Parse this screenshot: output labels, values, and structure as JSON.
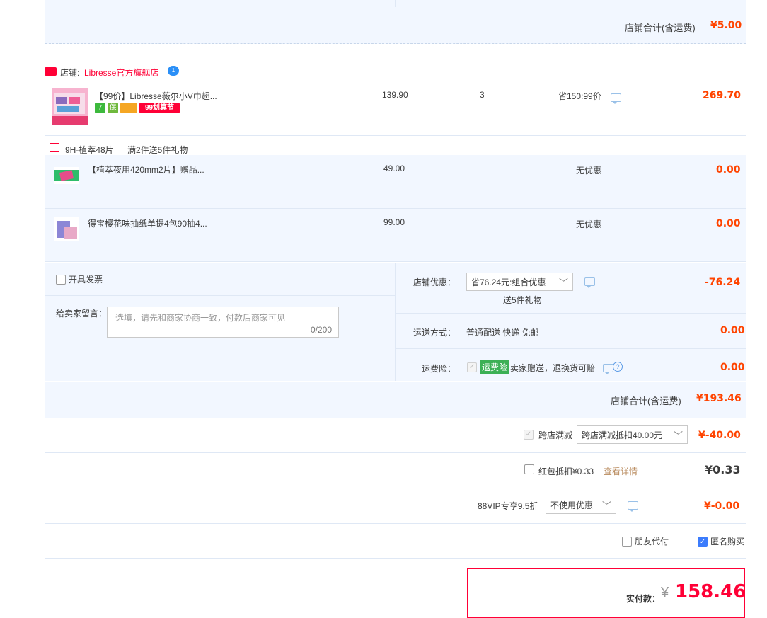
{
  "top_summary": {
    "label": "店铺合计(含运费)",
    "amount": "¥5.00"
  },
  "shop": {
    "badge": "天猫",
    "prefix": "店铺:",
    "name": "Libresse官方旗舰店",
    "chat_badge": "1"
  },
  "main_item": {
    "title": "【99价】Libresse薇尔小V巾超...",
    "unit_price": "139.90",
    "quantity": "3",
    "promo": "省150:99价",
    "total": "269.70",
    "tags": [
      "7",
      "保",
      "",
      "99划算节"
    ]
  },
  "gift_header": {
    "title": "9H-植萃48片",
    "rule": "满2件送5件礼物"
  },
  "gifts": [
    {
      "title": "【植萃夜用420mm2片】赠品...",
      "price": "49.00",
      "promo": "无优惠",
      "total": "0.00"
    },
    {
      "title": "得宝樱花味抽纸单提4包90抽4...",
      "price": "99.00",
      "promo": "无优惠",
      "total": "0.00"
    }
  ],
  "invoice": {
    "label": "开具发票"
  },
  "message": {
    "label": "给卖家留言：",
    "placeholder": "选填，请先和商家协商一致，付款后商家可见",
    "counter": "0/200"
  },
  "shop_discount": {
    "label": "店铺优惠：",
    "selected": "省76.24元:组合优惠",
    "note": "送5件礼物",
    "amount": "-76.24"
  },
  "shipping": {
    "label": "运送方式：",
    "value": "普通配送 快递 免邮",
    "amount": "0.00"
  },
  "insurance": {
    "label": "运费险：",
    "badge": "运费险",
    "text": "卖家赠送，退换货可赔",
    "help": "?",
    "amount": "0.00"
  },
  "shop_total": {
    "label": "店铺合计(含运费)",
    "amount": "¥193.46"
  },
  "cross_store": {
    "label": "跨店满减",
    "selected": "跨店满减抵扣40.00元",
    "amount": "¥-40.00"
  },
  "red_packet": {
    "label": "红包抵扣¥0.33",
    "link": "查看详情",
    "amount": "¥0.33"
  },
  "vip": {
    "label": "88VIP专享9.5折",
    "selected": "不使用优惠",
    "amount": "¥-0.00"
  },
  "pay_options": {
    "friend_pay": "朋友代付",
    "anonymous": "匿名购买"
  },
  "final": {
    "label": "实付款：",
    "currency": "¥",
    "amount": "158.46"
  },
  "colors": {
    "accent_red": "#ff0036",
    "price_red": "#f40",
    "light_blue": "#f2f7ff",
    "check_blue": "#3c7cfc"
  }
}
